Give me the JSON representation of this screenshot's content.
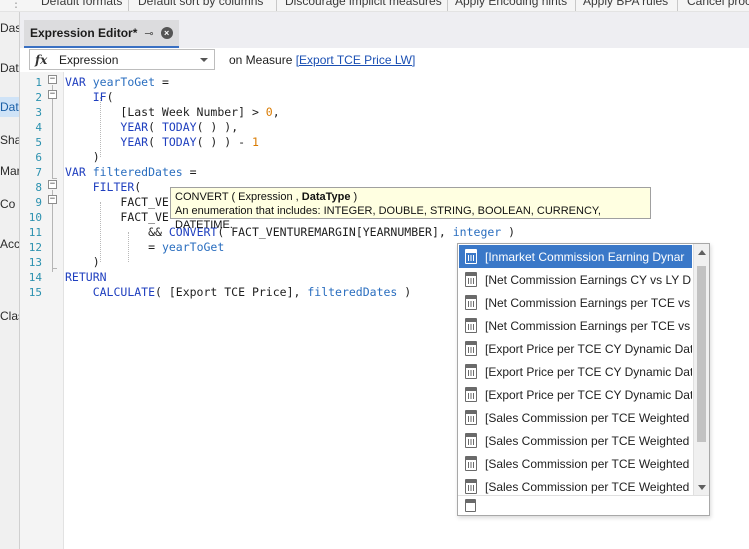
{
  "toolbar": {
    "commands": [
      "Default formats",
      "Default sort by columns",
      "Discourage implicit measures",
      "Apply Encoding hints",
      "Apply BPA rules",
      "Cancel proc"
    ]
  },
  "sidebar": {
    "items": [
      "Das",
      "Dat",
      "Dat",
      "Sha",
      "Mar",
      "Co",
      "Acc",
      "Clas"
    ]
  },
  "tab": {
    "title": "Expression Editor*"
  },
  "expression_bar": {
    "selected_property": "Expression",
    "measure_prefix": "on Measure",
    "measure_link": "[Export TCE Price LW]"
  },
  "editor": {
    "line_numbers": [
      "1",
      "2",
      "3",
      "4",
      "5",
      "6",
      "7",
      "8",
      "9",
      "10",
      "11",
      "12",
      "13",
      "14",
      "15"
    ],
    "code": {
      "l1_kw": "VAR",
      "l1_var": "yearToGet",
      "l1_op": " =",
      "l2_fn": "IF",
      "l3_text": "[Last Week Number] > ",
      "l3_num": "0",
      "l3_end": ",",
      "l4_fn1": "YEAR",
      "l4_fn2": "TODAY",
      "l4_end": "( ) ),",
      "l5_fn1": "YEAR",
      "l5_fn2": "TODAY",
      "l5_mid": "( ) ) - ",
      "l5_num": "1",
      "l6_text": ")",
      "l7_kw": "VAR",
      "l7_var": "filteredDates",
      "l7_op": " =",
      "l8_fn": "FILTER",
      "l9_text": "FACT_VE",
      "l10_text": "FACT_VE",
      "l11_op": "&& ",
      "l11_fn": "CONVERT",
      "l11_text": "( FACT_VENTUREMARGIN[YEARNUMBER], ",
      "l11_type": "integer",
      "l11_end": " )",
      "l12_op": "= ",
      "l12_var": "yearToGet",
      "l13_text": ")",
      "l14_kw": "RETURN",
      "l15_fn": "CALCULATE",
      "l15_text": "( [Export TCE Price], ",
      "l15_var": "filteredDates",
      "l15_end": " )"
    }
  },
  "tooltip": {
    "fn": "CONVERT",
    "open": " ( ",
    "param1": "Expression",
    "comma": " , ",
    "param2": "DataType",
    "close": " )",
    "description": "An enumeration that includes: INTEGER, DOUBLE, STRING, BOOLEAN, CURRENCY, DATETIME."
  },
  "intellisense": {
    "items": [
      "[Inmarket Commission Earning Dynar",
      "[Net Commission Earnings CY vs LY D",
      "[Net Commission Earnings per TCE vs",
      "[Net Commission Earnings per TCE vs",
      "[Export Price per TCE CY Dynamic Dat",
      "[Export Price per TCE CY Dynamic Dat",
      "[Export Price per TCE CY Dynamic Dat",
      "[Sales Commission per TCE Weighted",
      "[Sales Commission per TCE Weighted",
      "[Sales Commission per TCE Weighted",
      "[Sales Commission per TCE Weighted"
    ],
    "selected_index": 0
  },
  "colors": {
    "keyword": "#1f3fbf",
    "variable": "#2a6ebf",
    "number": "#d97a00",
    "selection": "#3a78c8",
    "tooltip_bg": "#ffffe1"
  }
}
